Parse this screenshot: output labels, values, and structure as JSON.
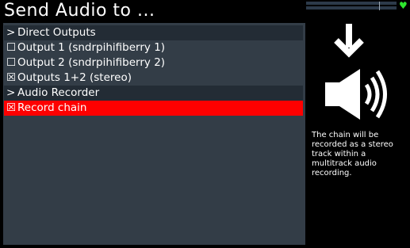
{
  "title": "Send Audio to ...",
  "status": {
    "heart_icon": "heart-icon",
    "heart_color": "#2ee62e"
  },
  "menu": {
    "items": [
      {
        "prefix": ">",
        "label": "Direct Outputs",
        "type": "header"
      },
      {
        "prefix": "☐",
        "label": "Output 1 (sndrpihifiberry 1)",
        "type": "option"
      },
      {
        "prefix": "☐",
        "label": "Output 2 (sndrpihifiberry 2)",
        "type": "option"
      },
      {
        "prefix": "☒",
        "label": "Outputs 1+2 (stereo)",
        "type": "option"
      },
      {
        "prefix": ">",
        "label": "Audio Recorder",
        "type": "header"
      },
      {
        "prefix": "☒",
        "label": "Record chain",
        "type": "option-selected"
      }
    ]
  },
  "info": {
    "icon": "speaker-volume-icon",
    "text": "The chain will be recorded as a stereo track within a multitrack audio recording."
  },
  "colors": {
    "panel_bg": "#333d47",
    "header_bg": "#232c35",
    "selected_bg": "#ff0000"
  }
}
